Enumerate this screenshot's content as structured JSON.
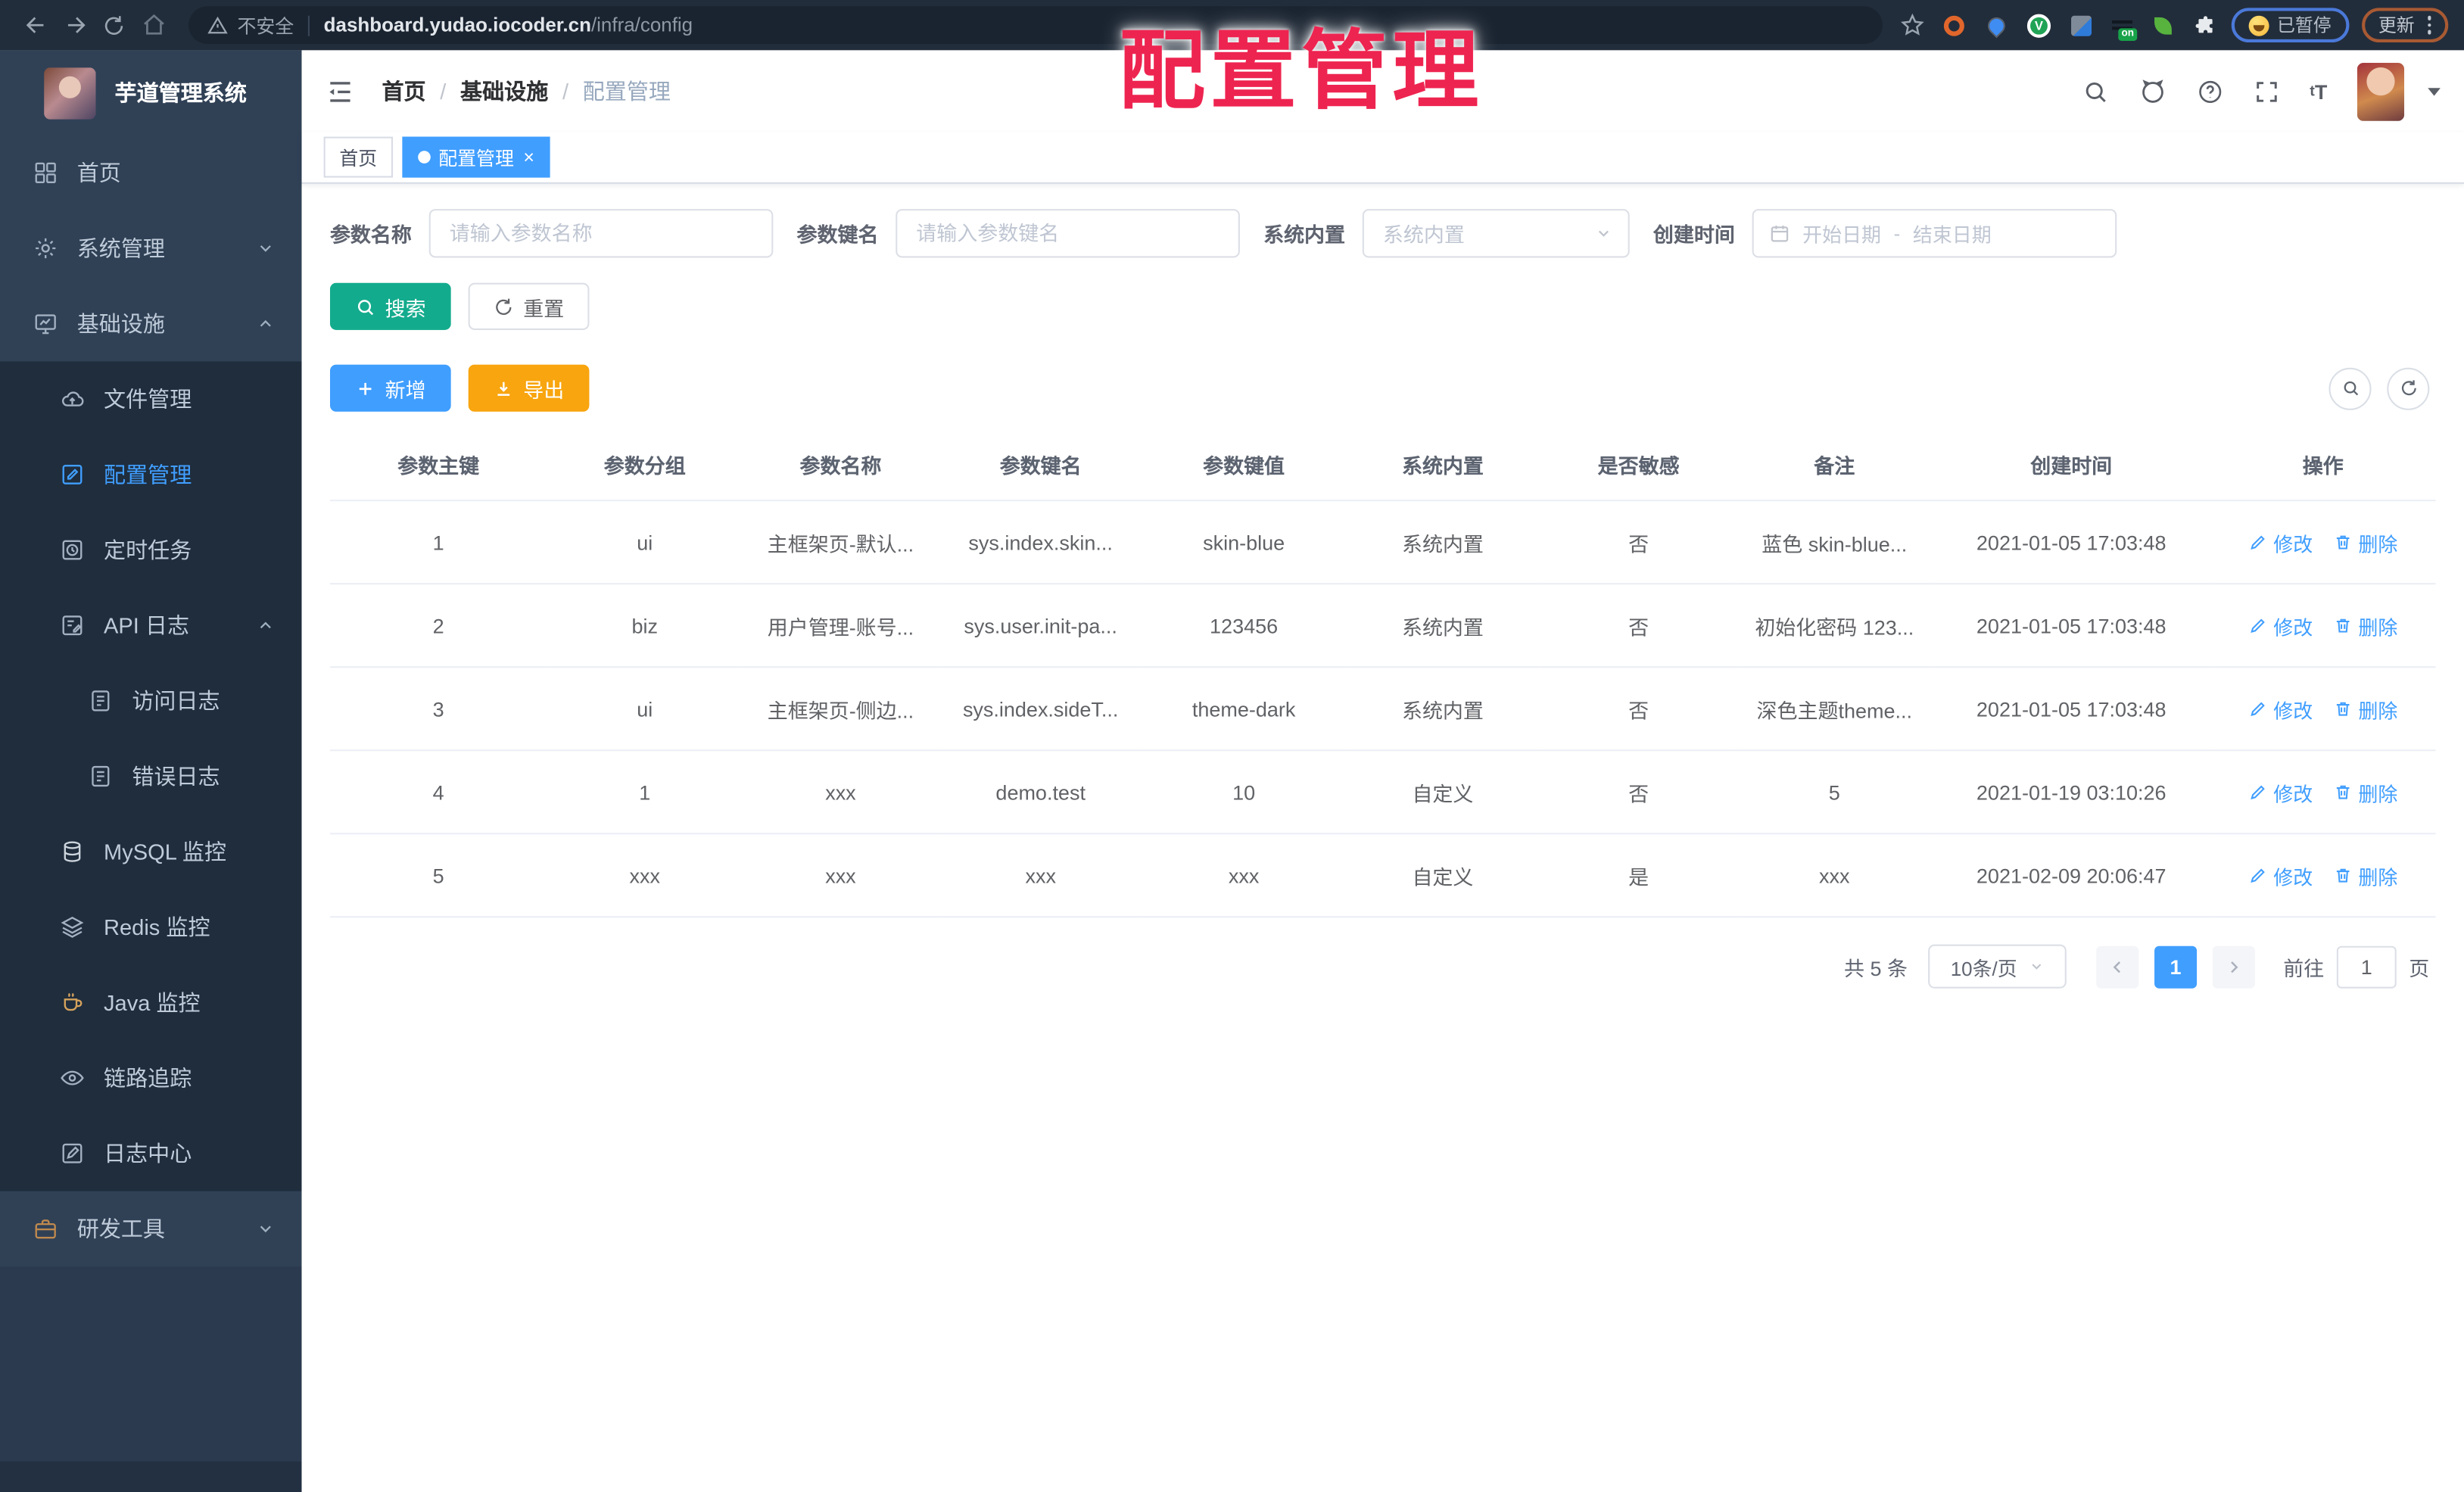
{
  "colors": {
    "primary": "#409eff",
    "search_btn": "#13ab8d",
    "export_btn": "#f8a50f",
    "overlay_red": "#ee2450",
    "sidebar_bg": "#304156",
    "submenu_bg": "#1f2d3d"
  },
  "overlay_title": "配置管理",
  "browser": {
    "security_label": "不安全",
    "url_host": "dashboard.yudao.iocoder.cn",
    "url_path": "/infra/config",
    "paused_badge": "已暂停",
    "update_button": "更新"
  },
  "sidebar": {
    "app_title": "芋道管理系统",
    "items": [
      {
        "id": "home",
        "label": "首页",
        "icon": "dashboard-icon",
        "level": 1,
        "dark": false,
        "active": false,
        "arrow": null
      },
      {
        "id": "system",
        "label": "系统管理",
        "icon": "gear-icon",
        "level": 1,
        "dark": false,
        "active": false,
        "arrow": "down"
      },
      {
        "id": "infra",
        "label": "基础设施",
        "icon": "monitor-icon",
        "level": 1,
        "dark": false,
        "active": false,
        "arrow": "up"
      },
      {
        "id": "file",
        "label": "文件管理",
        "icon": "cloud-icon",
        "level": 2,
        "dark": true,
        "active": false,
        "arrow": null
      },
      {
        "id": "config",
        "label": "配置管理",
        "icon": "edit-square-icon",
        "level": 2,
        "dark": true,
        "active": true,
        "arrow": null
      },
      {
        "id": "job",
        "label": "定时任务",
        "icon": "clock-icon",
        "level": 2,
        "dark": true,
        "active": false,
        "arrow": null
      },
      {
        "id": "api-log",
        "label": "API 日志",
        "icon": "log-icon",
        "level": 2,
        "dark": true,
        "active": false,
        "arrow": "up"
      },
      {
        "id": "access-log",
        "label": "访问日志",
        "icon": "doc-icon",
        "level": 3,
        "dark": true,
        "active": false,
        "arrow": null
      },
      {
        "id": "error-log",
        "label": "错误日志",
        "icon": "doc-icon",
        "level": 3,
        "dark": true,
        "active": false,
        "arrow": null
      },
      {
        "id": "mysql",
        "label": "MySQL 监控",
        "icon": "db-icon",
        "level": 2,
        "dark": true,
        "active": false,
        "arrow": null
      },
      {
        "id": "redis",
        "label": "Redis 监控",
        "icon": "layers-icon",
        "level": 2,
        "dark": true,
        "active": false,
        "arrow": null
      },
      {
        "id": "java",
        "label": "Java 监控",
        "icon": "java-icon",
        "level": 2,
        "dark": true,
        "active": false,
        "arrow": null
      },
      {
        "id": "trace",
        "label": "链路追踪",
        "icon": "eye-icon",
        "level": 2,
        "dark": true,
        "active": false,
        "arrow": null
      },
      {
        "id": "log-center",
        "label": "日志中心",
        "icon": "pen-square-icon",
        "level": 2,
        "dark": true,
        "active": false,
        "arrow": null
      },
      {
        "id": "devtool",
        "label": "研发工具",
        "icon": "briefcase-icon",
        "level": 1,
        "dark": false,
        "active": false,
        "arrow": "down"
      }
    ]
  },
  "header": {
    "breadcrumb": [
      "首页",
      "基础设施",
      "配置管理"
    ],
    "separator": "/"
  },
  "tabs": [
    {
      "label": "首页",
      "active": false,
      "close": ""
    },
    {
      "label": "配置管理",
      "active": true,
      "close": "×"
    }
  ],
  "filters": {
    "name": {
      "label": "参数名称",
      "placeholder": "请输入参数名称"
    },
    "key": {
      "label": "参数键名",
      "placeholder": "请输入参数键名"
    },
    "type": {
      "label": "系统内置",
      "placeholder": "系统内置"
    },
    "date": {
      "label": "创建时间",
      "start_placeholder": "开始日期",
      "separator": "-",
      "end_placeholder": "结束日期"
    }
  },
  "toolbar": {
    "search_label": "搜索",
    "reset_label": "重置",
    "add_label": "新增",
    "export_label": "导出"
  },
  "table": {
    "columns": [
      "参数主键",
      "参数分组",
      "参数名称",
      "参数键名",
      "参数键值",
      "系统内置",
      "是否敏感",
      "备注",
      "创建时间",
      "操作"
    ],
    "rows": [
      {
        "cells": [
          "1",
          "ui",
          "主框架页-默认...",
          "sys.index.skin...",
          "skin-blue",
          "系统内置",
          "否",
          "蓝色 skin-blue...",
          "2021-01-05 17:03:48"
        ]
      },
      {
        "cells": [
          "2",
          "biz",
          "用户管理-账号...",
          "sys.user.init-pa...",
          "123456",
          "系统内置",
          "否",
          "初始化密码 123...",
          "2021-01-05 17:03:48"
        ]
      },
      {
        "cells": [
          "3",
          "ui",
          "主框架页-侧边...",
          "sys.index.sideT...",
          "theme-dark",
          "系统内置",
          "否",
          "深色主题theme...",
          "2021-01-05 17:03:48"
        ]
      },
      {
        "cells": [
          "4",
          "1",
          "xxx",
          "demo.test",
          "10",
          "自定义",
          "否",
          "5",
          "2021-01-19 03:10:26"
        ]
      },
      {
        "cells": [
          "5",
          "xxx",
          "xxx",
          "xxx",
          "xxx",
          "自定义",
          "是",
          "xxx",
          "2021-02-09 20:06:47"
        ]
      }
    ],
    "actions": {
      "edit": "修改",
      "delete": "删除"
    }
  },
  "pagination": {
    "total_text": "共 5 条",
    "page_size": "10条/页",
    "current_page": "1",
    "goto_label": "前往",
    "page_unit": "页"
  }
}
